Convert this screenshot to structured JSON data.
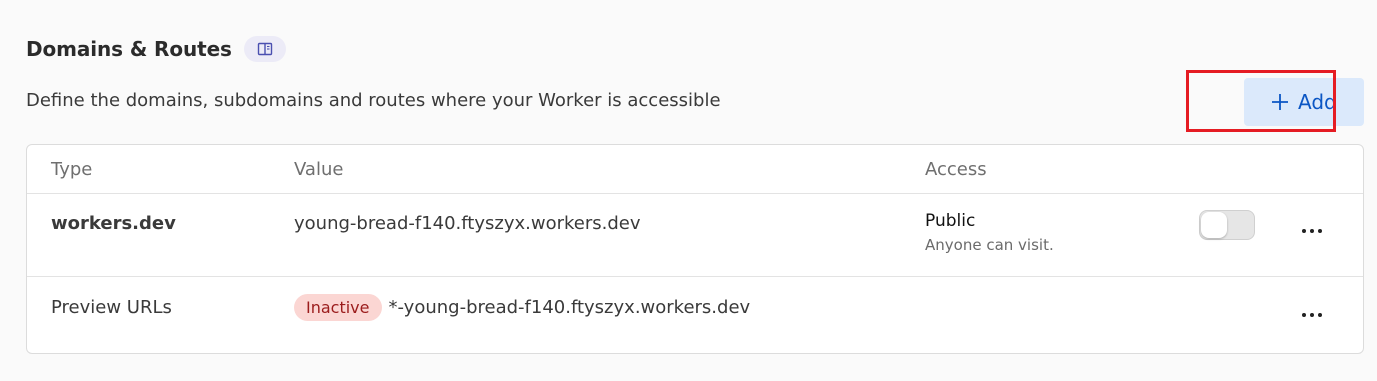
{
  "section": {
    "title": "Domains & Routes",
    "docs_icon": "book-icon",
    "subtitle": "Define the domains, subdomains and routes where your Worker is accessible"
  },
  "toolbar": {
    "add_label": "Add",
    "add_icon": "plus-icon"
  },
  "table": {
    "headers": {
      "type": "Type",
      "value": "Value",
      "access": "Access"
    },
    "rows": [
      {
        "type": "workers.dev",
        "value": "young-bread-f140.ftyszyx.workers.dev",
        "access_title": "Public",
        "access_desc": "Anyone can visit.",
        "toggle_on": false
      },
      {
        "type": "Preview URLs",
        "badge": "Inactive",
        "value": "*-young-bread-f140.ftyszyx.workers.dev"
      }
    ]
  },
  "colors": {
    "accent": "#0b56c4",
    "add_bg": "#dbe9fb",
    "badge_bg": "#fbd6d3",
    "highlight": "#e51c23"
  }
}
